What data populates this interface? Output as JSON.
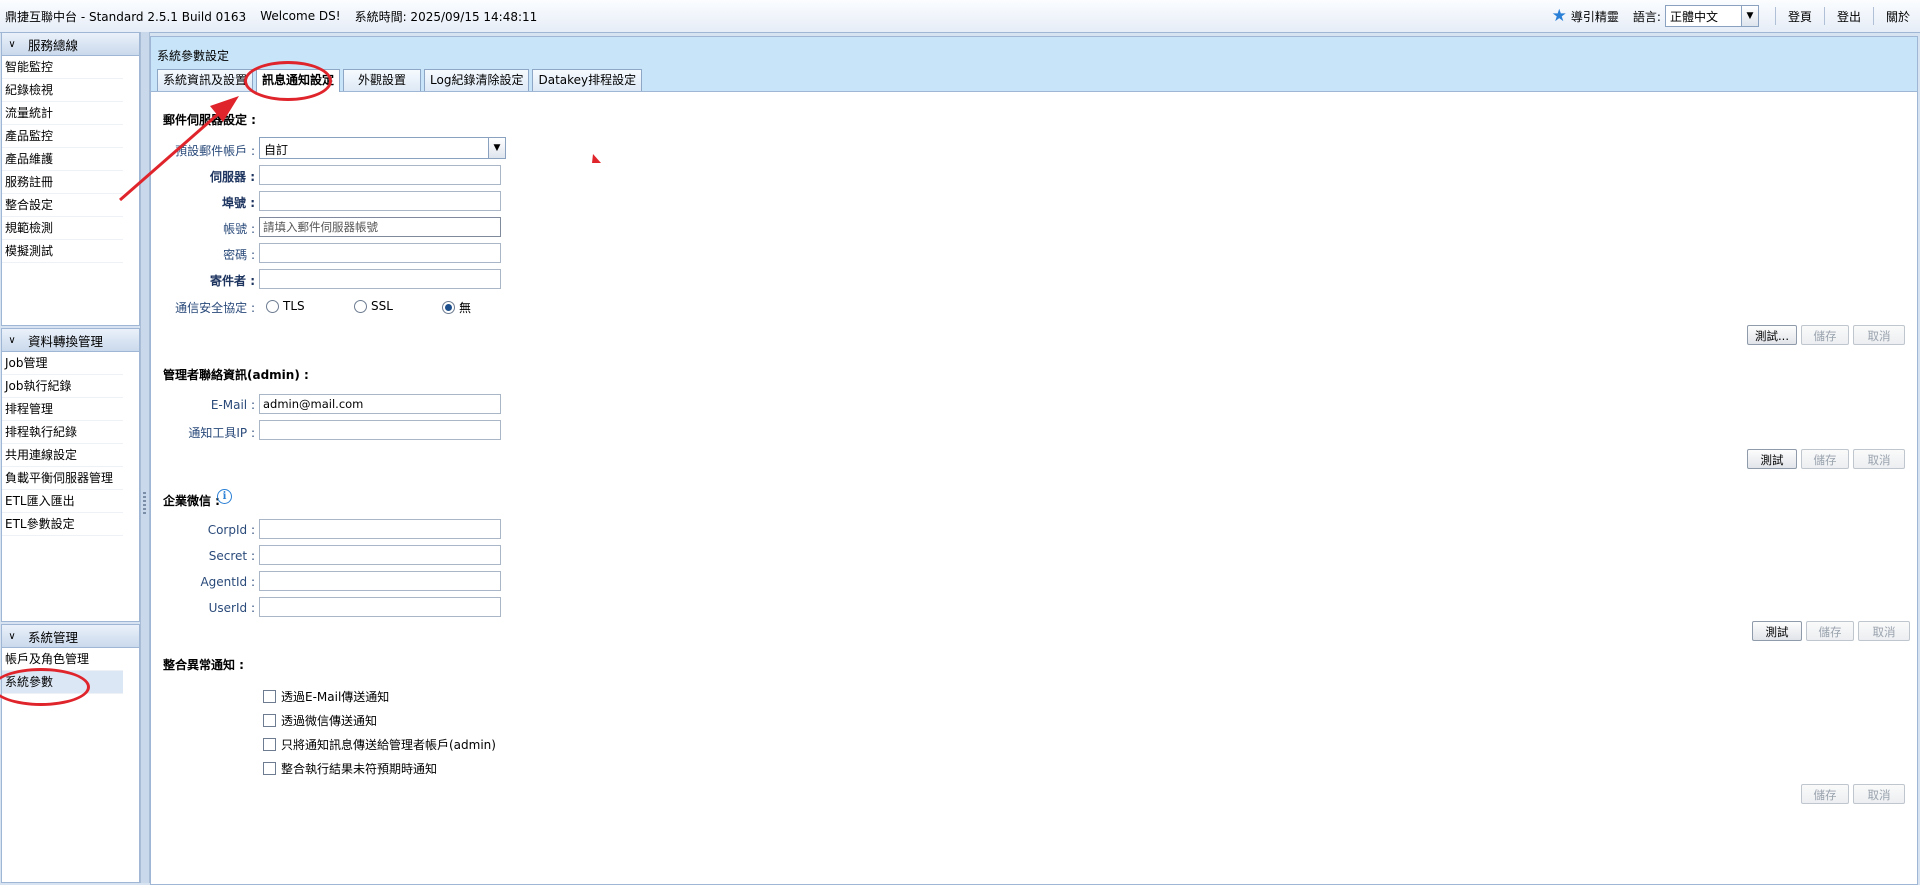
{
  "topbar": {
    "app_title": "鼎捷互聯中台 - Standard 2.5.1 Build 0163",
    "welcome": "Welcome DS!",
    "system_time": "系統時間: 2025/09/15 14:48:11",
    "wizard": "導引精靈",
    "language_label": "語言:",
    "language_value": "正體中文",
    "home": "登頁",
    "logout": "登出",
    "about": "關於"
  },
  "sidebar": {
    "panels": [
      {
        "title": "服務總線",
        "items": [
          "智能監控",
          "紀錄檢視",
          "流量統計",
          "產品監控",
          "產品維護",
          "服務註冊",
          "整合設定",
          "規範檢測",
          "模擬測試"
        ]
      },
      {
        "title": "資料轉換管理",
        "items": [
          "Job管理",
          "Job執行紀錄",
          "排程管理",
          "排程執行紀錄",
          "共用連線設定",
          "負載平衡伺服器管理",
          "ETL匯入匯出",
          "ETL參數設定"
        ]
      },
      {
        "title": "系統管理",
        "items": [
          "帳戶及角色管理",
          "系統參數"
        ]
      }
    ]
  },
  "content": {
    "title": "系統參數設定",
    "tabs": [
      "系統資訊及設置",
      "訊息通知設定",
      "外觀設置",
      "Log紀錄清除設定",
      "Datakey排程設定"
    ],
    "mail": {
      "section": "郵件伺服器設定 :",
      "account_label": "預設郵件帳戶 :",
      "account_value": "自訂",
      "server_label": "伺服器 :",
      "server_value": "",
      "port_label": "埠號 :",
      "port_value": "",
      "user_label": "帳號 :",
      "user_placeholder": "請填入郵件伺服器帳號",
      "password_label": "密碼 :",
      "password_value": "",
      "sender_label": "寄件者 :",
      "sender_value": "",
      "security_label": "通信安全協定 :",
      "security_options": [
        "TLS",
        "SSL",
        "無"
      ],
      "security_selected": "無",
      "btn_test": "測試...",
      "btn_save": "儲存",
      "btn_cancel": "取消"
    },
    "admin": {
      "section": "管理者聯絡資訊(admin) :",
      "email_label": "E-Mail :",
      "email_value": "admin@mail.com",
      "ip_label": "通知工具IP :",
      "ip_value": "",
      "btn_test": "測試",
      "btn_save": "儲存",
      "btn_cancel": "取消"
    },
    "wechat": {
      "section": "企業微信 :",
      "corpid_label": "CorpId :",
      "secret_label": "Secret :",
      "agentid_label": "AgentId :",
      "userid_label": "UserId :",
      "btn_test": "測試",
      "btn_save": "儲存",
      "btn_cancel": "取消"
    },
    "alert": {
      "section": "整合異常通知 :",
      "options": [
        "透過E-Mail傳送通知",
        "透過微信傳送通知",
        "只將通知訊息傳送給管理者帳戶(admin)",
        "整合執行結果未符預期時通知"
      ],
      "btn_save": "儲存",
      "btn_cancel": "取消"
    }
  },
  "colors": {
    "annotation": "#e0242b",
    "header_bg": "#c7e4f8",
    "accent": "#2a7fd6"
  }
}
